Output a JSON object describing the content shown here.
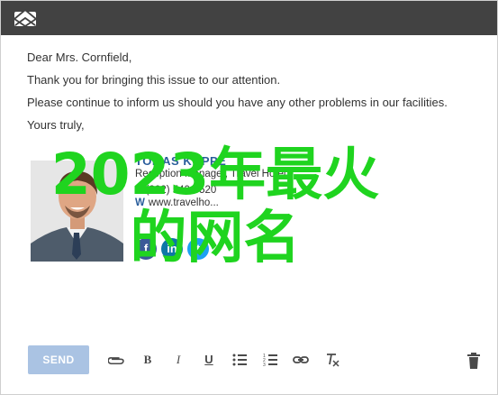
{
  "email": {
    "lines": [
      "Dear Mrs. Cornfield,",
      "Thank you for bringing this issue to our attention.",
      "Please continue to inform us should you have any other problems in our facilities.",
      "Yours truly,"
    ]
  },
  "signature": {
    "name": "TOMAS KOPPE",
    "title": "Reception Manager, Travel Hotel",
    "phone_prefix": "P",
    "phone": "(302) 540-6520",
    "web_prefix": "W",
    "web": "www.travelho..."
  },
  "overlay": {
    "line1": "2023年最火",
    "line2": "的网名"
  },
  "toolbar": {
    "send_label": "SEND",
    "bold_label": "B",
    "italic_label": "I",
    "underline_label": "U"
  },
  "colors": {
    "titlebar": "#424242",
    "send": "#aac3e3",
    "accent": "#2a5d9b",
    "overlay": "#1fd41f"
  }
}
